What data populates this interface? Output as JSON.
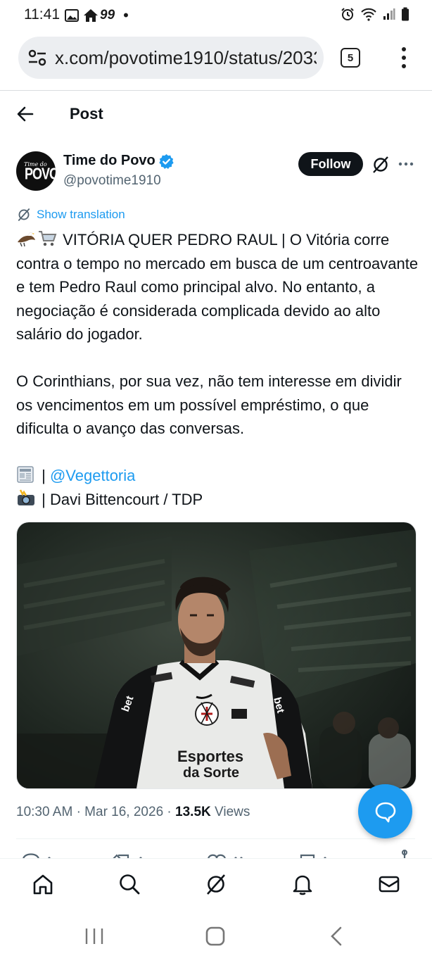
{
  "status_bar": {
    "time": "11:41",
    "badge": "99"
  },
  "browser": {
    "url": "x.com/povotime1910/status/2033",
    "tab_count": "5"
  },
  "header": {
    "title": "Post"
  },
  "author": {
    "name": "Time do Povo",
    "handle": "@povotime1910",
    "avatar_text_top": "Time do",
    "avatar_text_main": "POVO",
    "follow_label": "Follow"
  },
  "translation_label": "Show translation",
  "tweet": {
    "paragraph1": "VITÓRIA QUER PEDRO RAUL | O Vitória corre contra o tempo no mercado em busca de um centroavante e tem Pedro Raul como principal alvo. No entanto, a negociação é considerada complicada devido ao alto salário do jogador.",
    "paragraph2": "O Corinthians, por sua vez, não tem interesse em dividir os vencimentos em um possível empréstimo, o que dificulta o avanço das conversas.",
    "source_sep": "|",
    "source_link": "@Vegettoria",
    "photo_credit": "| Davi Bittencourt / TDP",
    "emojis": [
      "eagle",
      "shopping-cart",
      "newspaper",
      "camera-with-flash"
    ]
  },
  "photo": {
    "jersey_text_1": "Esportes",
    "jersey_text_2": "da Sorte",
    "sleeve_text": "bet"
  },
  "meta": {
    "time": "10:30 AM",
    "dot1": "·",
    "date": "Mar 16, 2026",
    "dot2": "·",
    "views_count": "13.5K",
    "views_label": "Views"
  },
  "bottom_nav": [
    "home-icon",
    "search-icon",
    "grok-icon",
    "notifications-icon",
    "messages-icon"
  ],
  "colors": {
    "accent": "#1d9bf0",
    "text": "#0f1419",
    "secondary": "#536471"
  }
}
